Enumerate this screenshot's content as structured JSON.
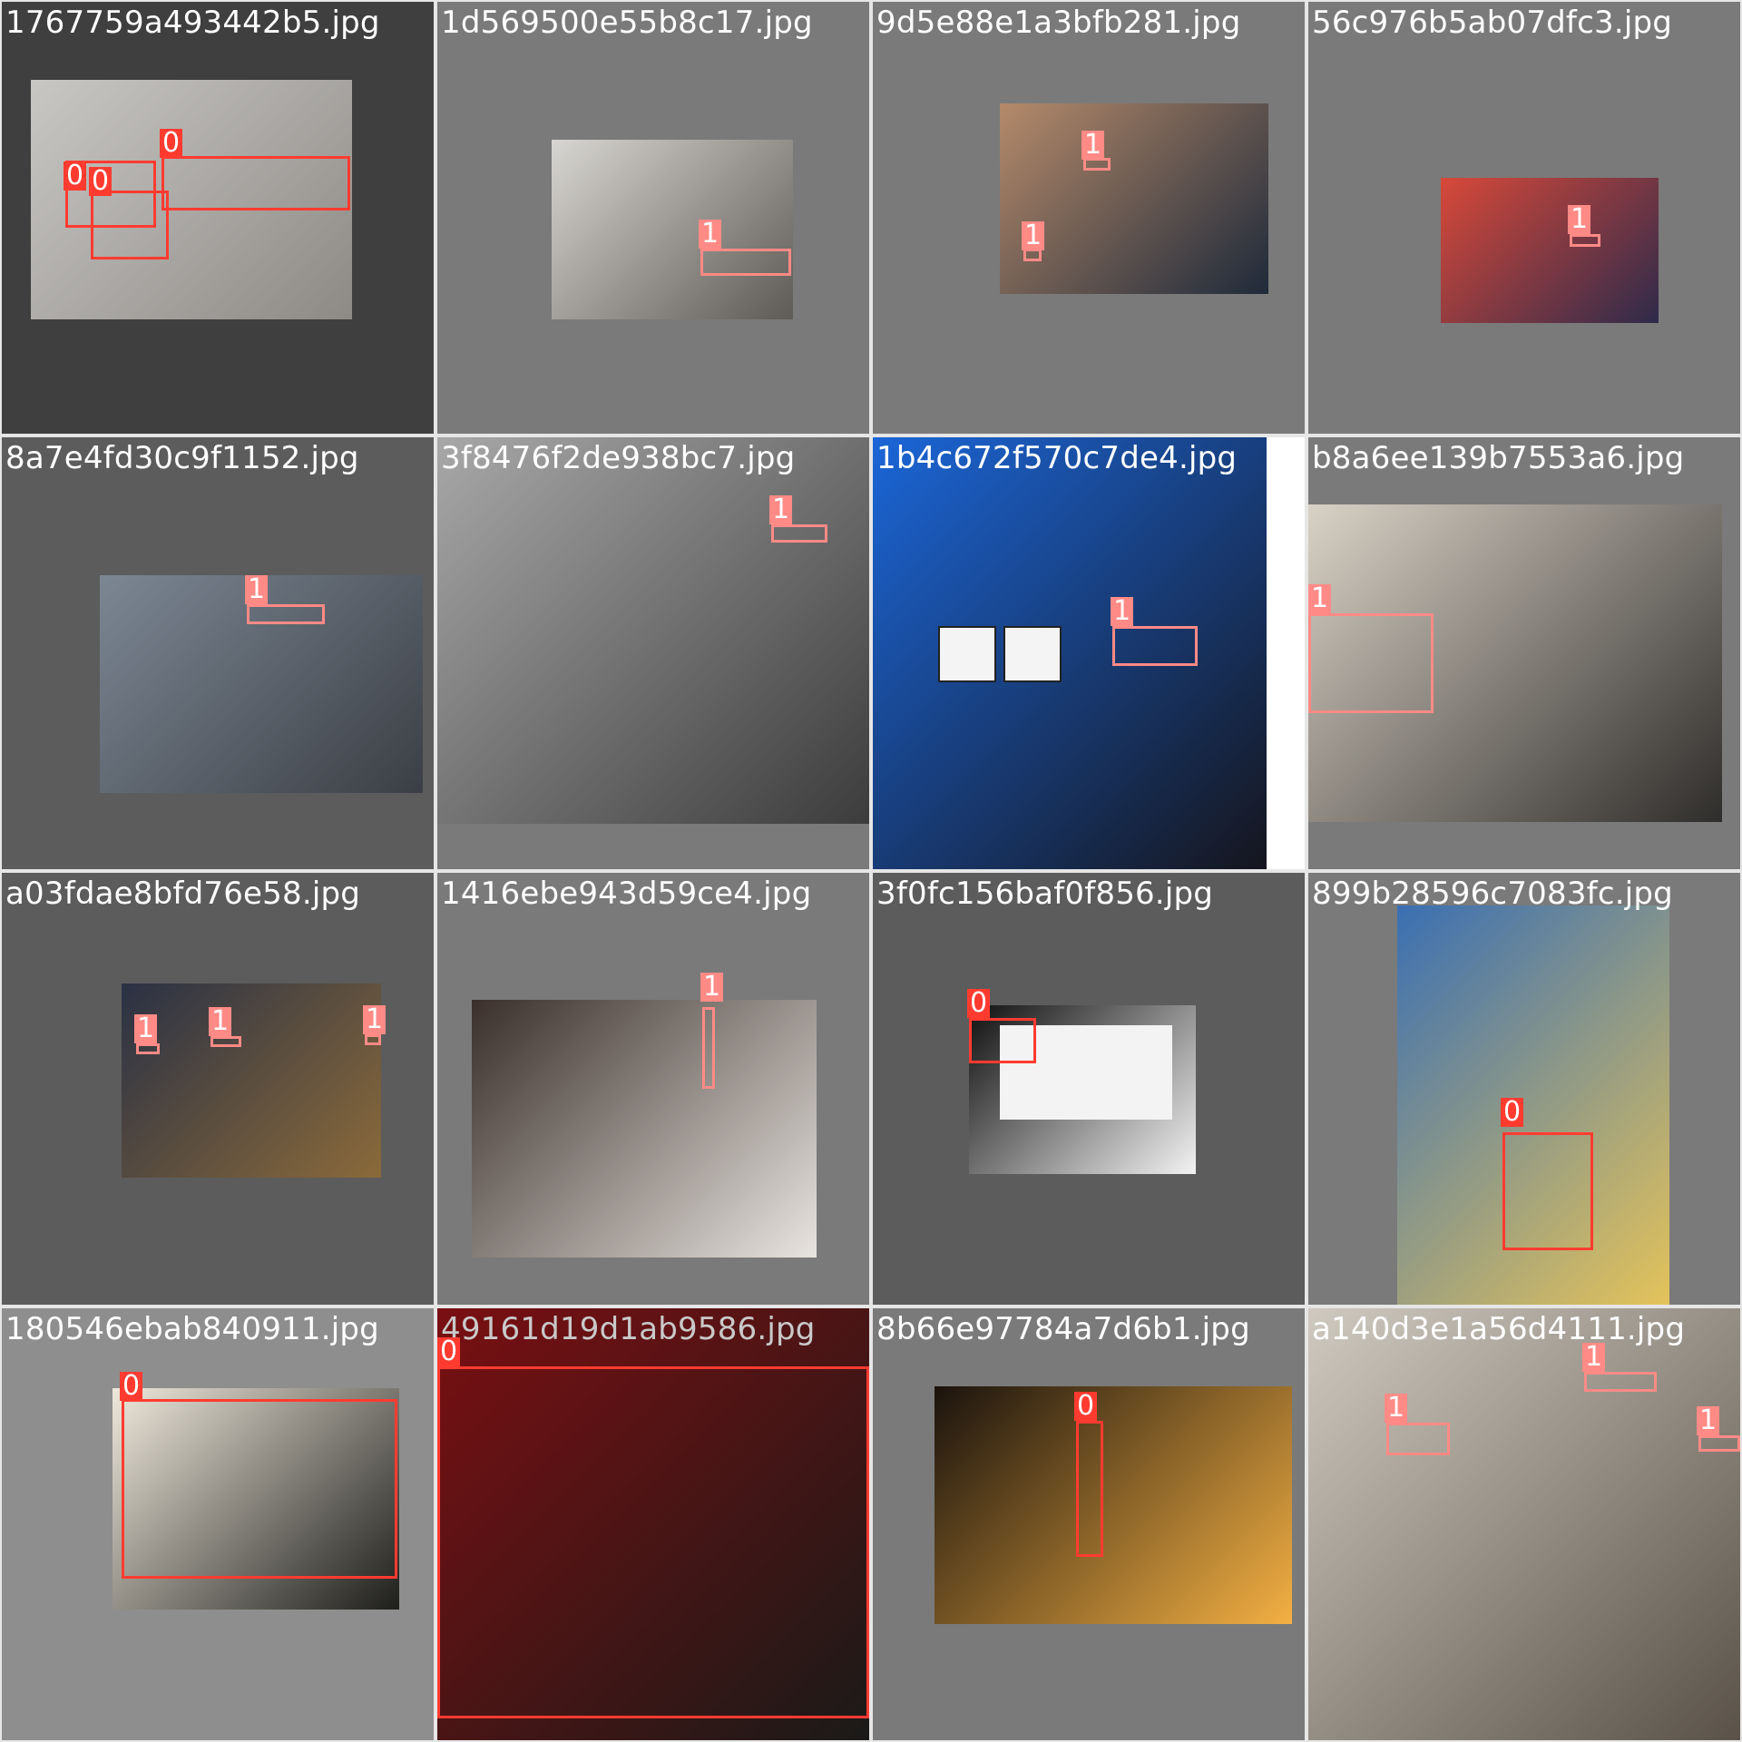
{
  "mosaic": {
    "tiles": [
      {
        "filename": "1767759a493442b5.jpg",
        "bg": "#3f3f3f",
        "photo_colors": [
          "#c9c7c4",
          "#8d8a86"
        ],
        "labels": [
          "0",
          "0",
          "0"
        ]
      },
      {
        "filename": "1d569500e55b8c17.jpg",
        "bg": "#7a7a7a",
        "photo_colors": [
          "#d8d6d2",
          "#5e5a55"
        ],
        "labels": [
          "1"
        ]
      },
      {
        "filename": "9d5e88e1a3bfb281.jpg",
        "bg": "#7a7a7a",
        "photo_colors": [
          "#b58a6a",
          "#1f2a3a"
        ],
        "labels": [
          "1",
          "1"
        ]
      },
      {
        "filename": "56c976b5ab07dfc3.jpg",
        "bg": "#7a7a7a",
        "photo_colors": [
          "#d8493a",
          "#2e2a4a"
        ],
        "labels": [
          "1"
        ]
      },
      {
        "filename": "8a7e4fd30c9f1152.jpg",
        "bg": "#5c5c5c",
        "photo_colors": [
          "#7c8794",
          "#3b3f45"
        ],
        "labels": [
          "1"
        ]
      },
      {
        "filename": "3f8476f2de938bc7.jpg",
        "bg": "#7a7a7a",
        "photo_colors": [
          "#a8a8a8",
          "#3c3c3c"
        ],
        "labels": [
          "1"
        ]
      },
      {
        "filename": "1b4c672f570c7de4.jpg",
        "bg": "#ffffff",
        "photo_colors": [
          "#1b66d8",
          "#15151d"
        ],
        "labels": [
          "1"
        ]
      },
      {
        "filename": "b8a6ee139b7553a6.jpg",
        "bg": "#7a7a7a",
        "photo_colors": [
          "#d9d2c6",
          "#2f2d2b"
        ],
        "labels": [
          "1"
        ]
      },
      {
        "filename": "a03fdae8bfd76e58.jpg",
        "bg": "#5c5c5c",
        "photo_colors": [
          "#2a3144",
          "#8b6a3a"
        ],
        "labels": [
          "1",
          "1",
          "1"
        ]
      },
      {
        "filename": "1416ebe943d59ce4.jpg",
        "bg": "#7a7a7a",
        "photo_colors": [
          "#3a2f2a",
          "#e8e4df"
        ],
        "labels": [
          "1"
        ]
      },
      {
        "filename": "3f0fc156baf0f856.jpg",
        "bg": "#5c5c5c",
        "photo_colors": [
          "#0f0f0f",
          "#f3f3f3"
        ],
        "labels": [
          "0"
        ]
      },
      {
        "filename": "899b28596c7083fc.jpg",
        "bg": "#7a7a7a",
        "photo_colors": [
          "#3a6fb3",
          "#e4c35a"
        ],
        "labels": [
          "0"
        ]
      },
      {
        "filename": "180546ebab840911.jpg",
        "bg": "#8e8e8e",
        "photo_colors": [
          "#efe9dc",
          "#1e1e1b"
        ],
        "labels": [
          "0"
        ]
      },
      {
        "filename": "49161d19d1ab9586.jpg",
        "bg": "#f4f2ee",
        "photo_colors": [
          "#7a0f12",
          "#1a1a18"
        ],
        "labels": [
          "0"
        ]
      },
      {
        "filename": "8b66e97784a7d6b1.jpg",
        "bg": "#7a7a7a",
        "photo_colors": [
          "#1a130d",
          "#f4b043"
        ],
        "labels": [
          "0"
        ]
      },
      {
        "filename": "a140d3e1a56d4111.jpg",
        "bg": "#dcdcd8",
        "photo_colors": [
          "#cfcac0",
          "#5a5248"
        ],
        "labels": [
          "1",
          "1",
          "1"
        ]
      }
    ]
  }
}
